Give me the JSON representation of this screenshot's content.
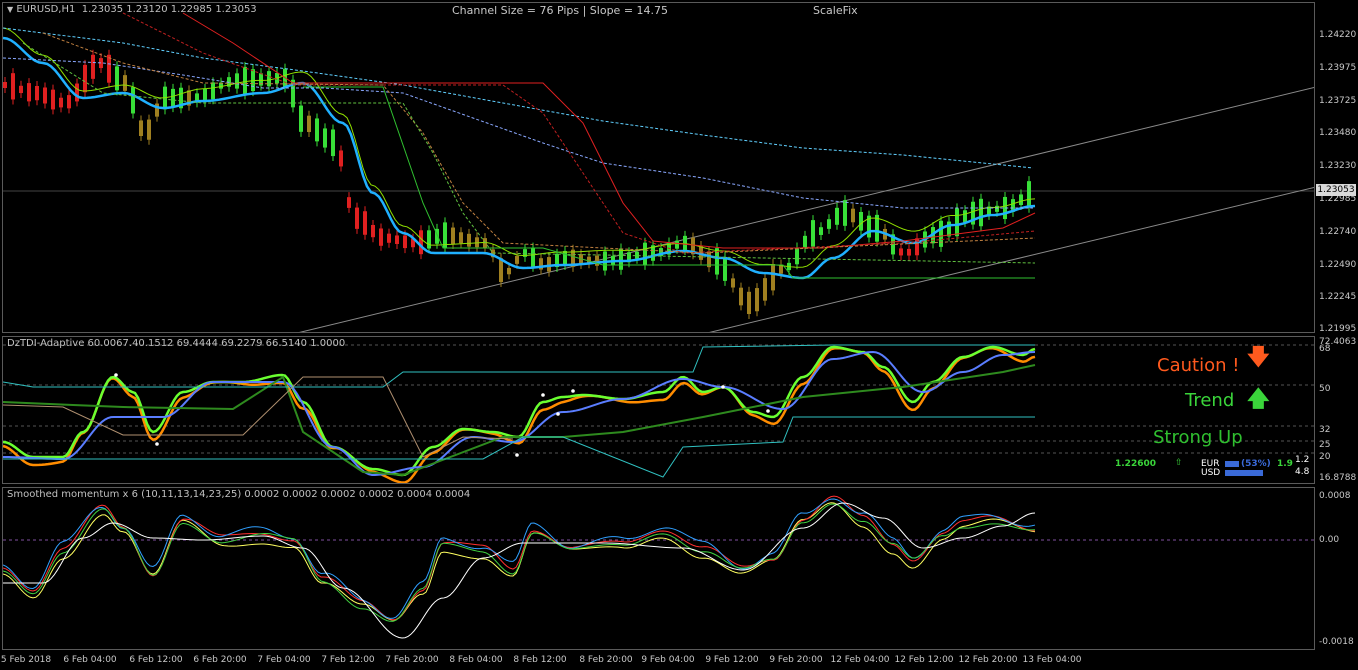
{
  "chart_header": {
    "symbol": "EURUSD,H1",
    "ohlc": "1.23035 1.23120 1.22985 1.23053",
    "channel": "Channel Size = 76 Pips  |  Slope = 14.75",
    "scalefix": "ScaleFix"
  },
  "price_axis": {
    "ticks": [
      "1.24220",
      "1.23975",
      "1.23725",
      "1.23480",
      "1.23230",
      "1.22985",
      "1.22740",
      "1.22490",
      "1.22245",
      "1.21995"
    ],
    "current_price": "1.23053"
  },
  "tdi": {
    "title": "DzTDI-Adaptive 60.0067.40.1512 69.4444 69.2279 66.5140 1.0000",
    "axis_ticks": [
      "72.4063",
      "68",
      "50",
      "32",
      "25",
      "20",
      "16.8788"
    ],
    "signals": {
      "caution": "Caution !",
      "trend": "Trend",
      "strong": "Strong Up"
    },
    "price_label": "1.22600",
    "up_symbol": "⇧",
    "currency_strength": {
      "eur_label": "EUR",
      "usd_label": "USD",
      "pct": "(53%)",
      "val1": "1.9",
      "val2": "1.2",
      "val3": "4.8"
    },
    "colors": {
      "caution": "#ff5a1e",
      "trend": "#3ad53a",
      "strong": "#2fbf2f"
    }
  },
  "momentum": {
    "title": "Smoothed momentum x 6 (10,11,13,14,23,25) 0.0002 0.0002 0.0002 0.0002 0.0004 0.0004",
    "axis_ticks": [
      "0.0008",
      "0.00",
      "-0.0018"
    ]
  },
  "time_axis": [
    "5 Feb 2018",
    "6 Feb 04:00",
    "6 Feb 12:00",
    "6 Feb 20:00",
    "7 Feb 04:00",
    "7 Feb 12:00",
    "7 Feb 20:00",
    "8 Feb 04:00",
    "8 Feb 12:00",
    "8 Feb 20:00",
    "9 Feb 04:00",
    "9 Feb 12:00",
    "9 Feb 20:00",
    "12 Feb 04:00",
    "12 Feb 12:00",
    "12 Feb 20:00",
    "13 Feb 04:00"
  ]
}
